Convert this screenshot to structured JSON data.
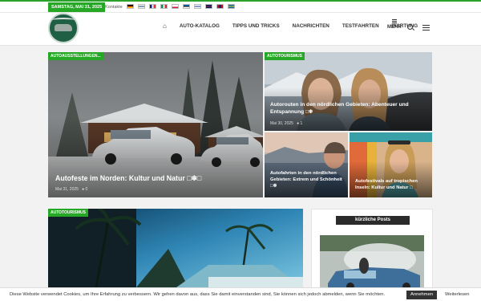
{
  "topbar": {
    "date": "SAMSTAG, MAI 31, 2025",
    "contact_label": "Kontakte",
    "flags": [
      {
        "name": "de-flag",
        "colors": [
          "#000000",
          "#dd0000",
          "#ffce00"
        ],
        "dir": "h"
      },
      {
        "name": "fi-flag",
        "colors": [
          "#ffffff",
          "#003580",
          "#ffffff"
        ],
        "dir": "h"
      },
      {
        "name": "fr-flag",
        "colors": [
          "#002395",
          "#ffffff",
          "#ed2939"
        ],
        "dir": "v"
      },
      {
        "name": "it-flag",
        "colors": [
          "#009246",
          "#ffffff",
          "#ce2b37"
        ],
        "dir": "v"
      },
      {
        "name": "pl-flag",
        "colors": [
          "#ffffff",
          "#ffffff",
          "#dc143c"
        ],
        "dir": "h"
      },
      {
        "name": "ee-flag",
        "colors": [
          "#0072ce",
          "#000000",
          "#ffffff"
        ],
        "dir": "h"
      },
      {
        "name": "il-flag",
        "colors": [
          "#ffffff",
          "#0038b8",
          "#ffffff"
        ],
        "dir": "h"
      },
      {
        "name": "gb-flag",
        "colors": [
          "#012169",
          "#c8102e",
          "#012169"
        ],
        "dir": "h"
      },
      {
        "name": "no-flag",
        "colors": [
          "#ba0c2f",
          "#00205b",
          "#ba0c2f"
        ],
        "dir": "v"
      },
      {
        "name": "se-flag",
        "colors": [
          "#006aa7",
          "#fecc00",
          "#006aa7"
        ],
        "dir": "h"
      }
    ]
  },
  "nav": {
    "items": [
      "AUTO-KATALOG",
      "TIPPS UND TRICKS",
      "NACHRICHTEN",
      "TESTFAHRTEN",
      "WARTUNG"
    ],
    "more_label": "MEHR"
  },
  "articles": {
    "main": {
      "category": "AUTOAUSSTELLUNGEN...",
      "title": "Autofeste im Norden: Kultur und Natur □❄□",
      "date": "Mai 31, 2025",
      "comments": "0"
    },
    "top_right": {
      "category": "AUTOTOURISMUS",
      "title": "Autorouten in den nördlichen Gebieten: Abenteuer und Entspannung □❄",
      "date": "Mai 30, 2025",
      "comments": "1"
    },
    "small_left": {
      "title": "Autofahrten in den nördlichen Gebieten: Extrem und Schönheit □❄"
    },
    "small_right": {
      "title": "Autofestivals auf tropischen Inseln: Kultur und Natur □"
    },
    "bottom": {
      "category": "AUTOTOURISMUS"
    }
  },
  "sidebar": {
    "title": "kürzliche Posts"
  },
  "cookie": {
    "text": "Diese Website verwendet Cookies, um Ihre Erfahrung zu verbessern. Wir gehen davon aus, dass Sie damit einverstanden sind, Sie können sich jedoch abmelden, wenn Sie möchten.",
    "accept_label": "Annehmen",
    "more_label": "Weiterlesen"
  },
  "colors": {
    "accent": "#26a826"
  }
}
